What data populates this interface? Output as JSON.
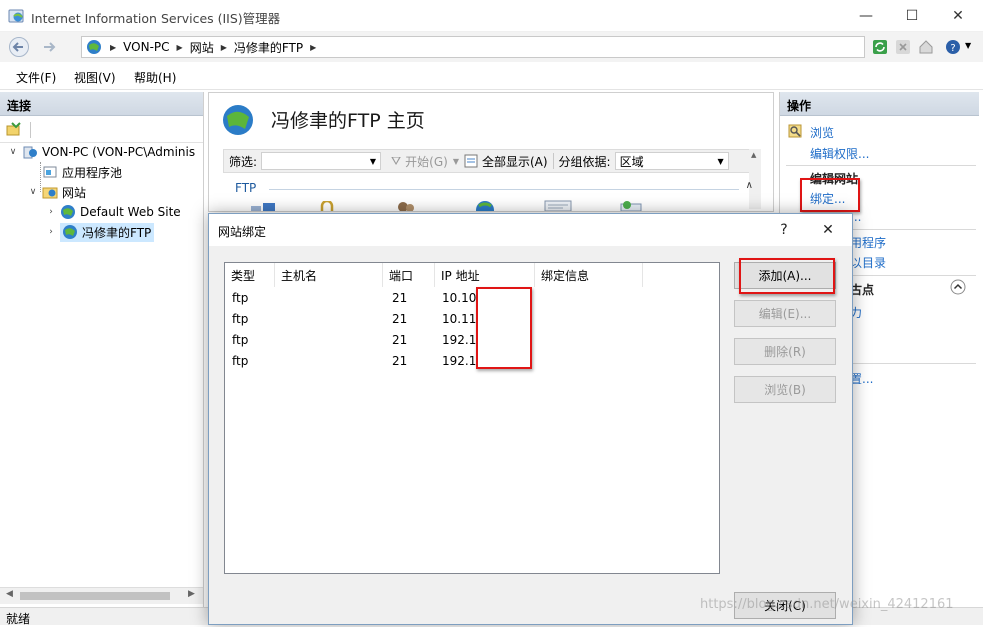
{
  "window": {
    "title": "Internet Information Services (IIS)管理器",
    "minimize": "—",
    "maximize": "☐",
    "close": "✕"
  },
  "address": {
    "crumbs": [
      "VON-PC",
      "网站",
      "冯修聿的FTP"
    ],
    "separator": "▶"
  },
  "menu": {
    "file": "文件(F)",
    "view": "视图(V)",
    "help": "帮助(H)"
  },
  "connections": {
    "header": "连接",
    "tree": {
      "server": "VON-PC (VON-PC\\Adminis",
      "app_pools": "应用程序池",
      "sites": "网站",
      "default_site": "Default Web Site",
      "ftp_site": "冯修聿的FTP"
    }
  },
  "center": {
    "page_title": "冯修聿的FTP 主页",
    "filter_label": "筛选:",
    "start_label": "开始(G)",
    "show_all_label": "全部显示(A)",
    "group_label": "分组依据:",
    "group_value": "区域",
    "group_name": "FTP"
  },
  "actions": {
    "header": "操作",
    "browse": "浏览",
    "edit_permissions": "编辑权限...",
    "edit_site_head": "编辑网站",
    "bindings": "绑定...",
    "app_partial": "用程序",
    "dir_partial": "以目录",
    "site_partial": "古点",
    "move_partial": "力",
    "set_partial": "置..."
  },
  "status": {
    "text": "就绪"
  },
  "dialog": {
    "title": "网站绑定",
    "help": "?",
    "close": "✕",
    "columns": [
      "类型",
      "主机名",
      "端口",
      "IP 地址",
      "绑定信息"
    ],
    "rows": [
      {
        "type": "ftp",
        "host": "",
        "port": "21",
        "ip": "10.100"
      },
      {
        "type": "ftp",
        "host": "",
        "port": "21",
        "ip": "10.11."
      },
      {
        "type": "ftp",
        "host": "",
        "port": "21",
        "ip": "192.16"
      },
      {
        "type": "ftp",
        "host": "",
        "port": "21",
        "ip": "192.16"
      }
    ],
    "buttons": {
      "add": "添加(A)...",
      "edit": "编辑(E)...",
      "remove": "删除(R)",
      "browse": "浏览(B)",
      "close": "关闭(C)"
    }
  },
  "watermark": "https://blog.csdn.net/weixin_42412161",
  "colors": {
    "link": "#1e6cc8",
    "highlight": "#e01515",
    "selection": "#cce8ff"
  }
}
